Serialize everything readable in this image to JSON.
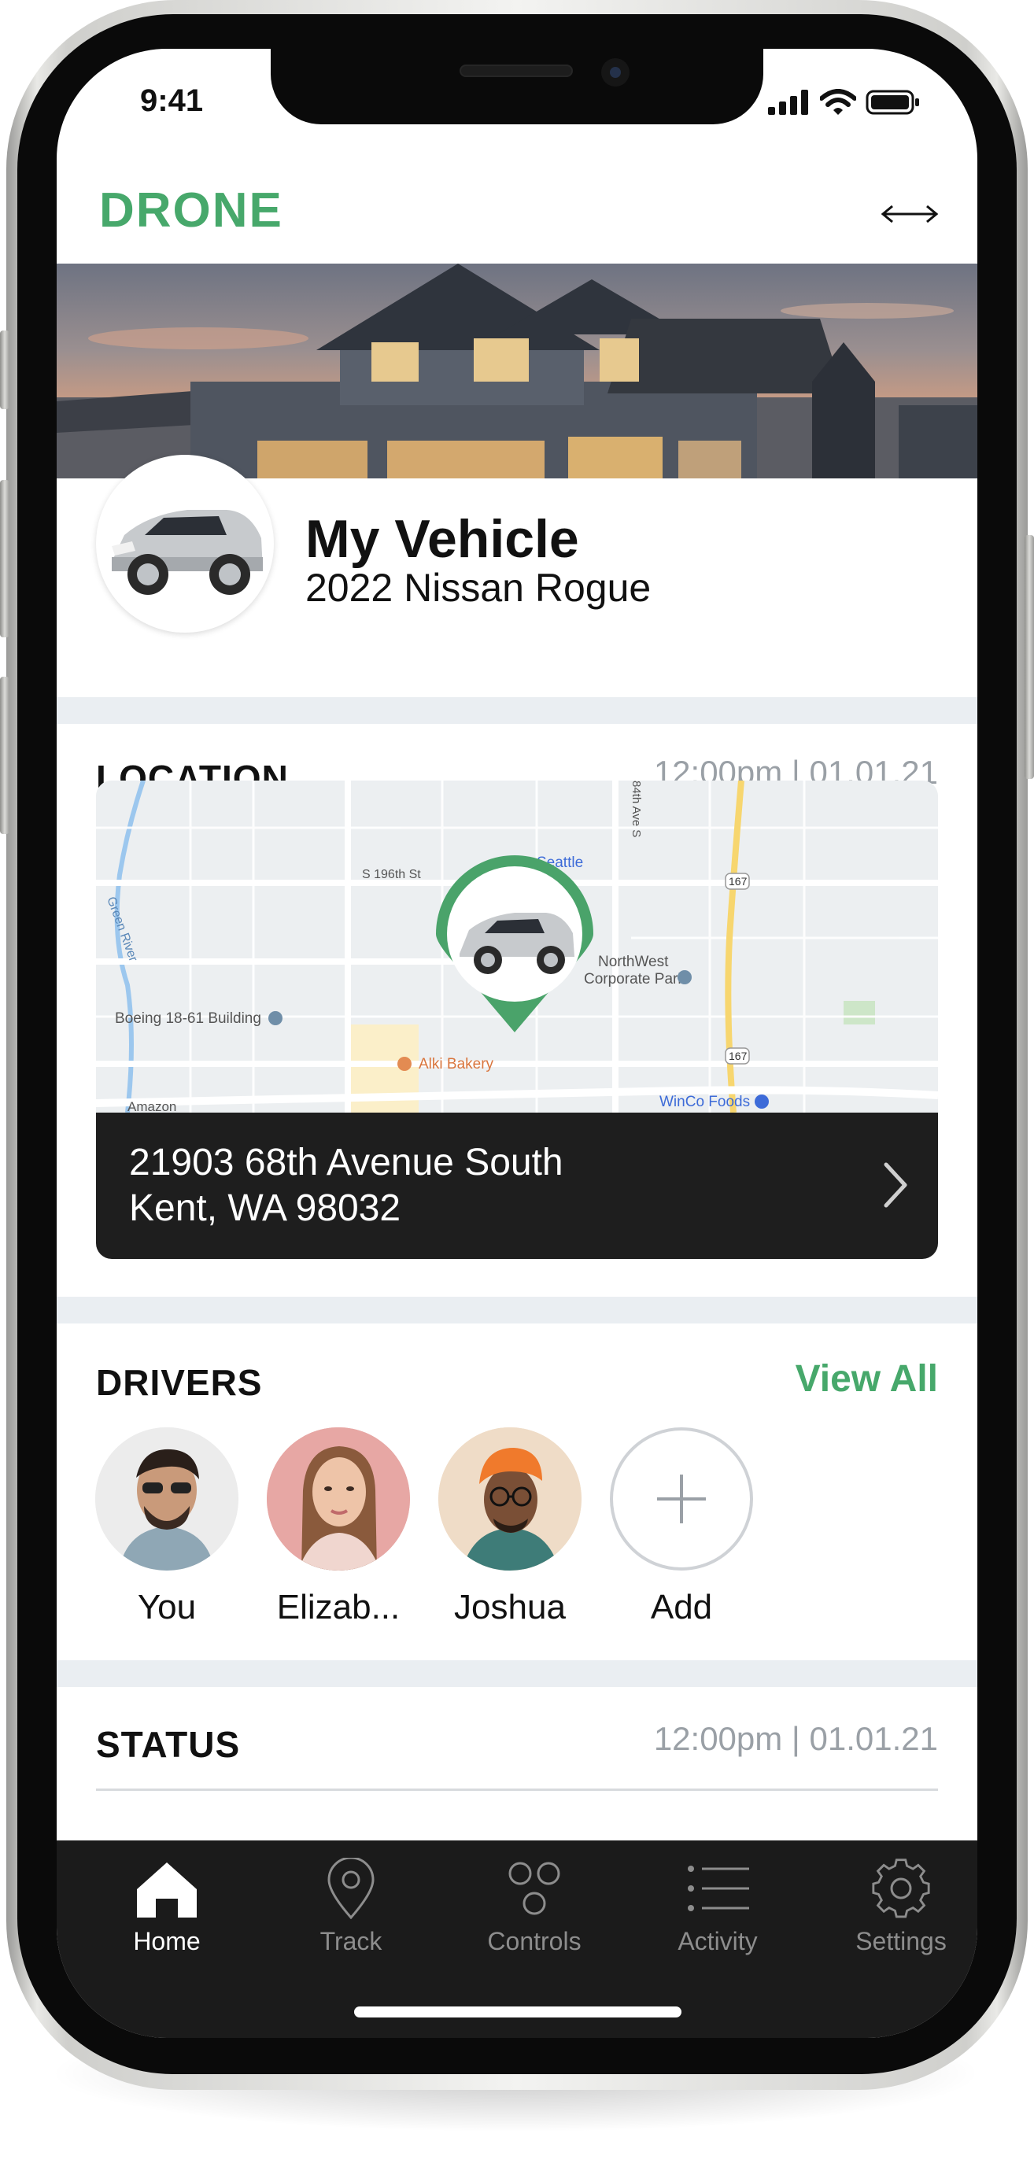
{
  "status_bar": {
    "time": "9:41"
  },
  "header": {
    "logo": "DRONE"
  },
  "vehicle": {
    "title": "My Vehicle",
    "model": "2022 Nissan Rogue"
  },
  "location": {
    "title": "LOCATION",
    "timestamp": "12:00pm | 01.01.21",
    "address_line1": "21903 68th Avenue South",
    "address_line2": "Kent, WA 98032",
    "map_labels": {
      "s196": "S 196th St",
      "seattle": "Seattle",
      "northwest": "NorthWest",
      "corporate_park": "Corporate Park",
      "boeing": "Boeing 18-61 Building",
      "alki": "Alki Bakery",
      "winco": "WinCo Foods",
      "green_river": "Green River",
      "ave84": "84th Ave S",
      "route_a": "167",
      "route_b": "167",
      "amazon": "Amazon"
    }
  },
  "drivers": {
    "title": "DRIVERS",
    "view_all": "View All",
    "items": [
      {
        "name": "You"
      },
      {
        "name": "Elizab..."
      },
      {
        "name": "Joshua"
      }
    ],
    "add_label": "Add"
  },
  "status": {
    "title": "STATUS",
    "timestamp": "12:00pm | 01.01.21"
  },
  "tabs": [
    {
      "label": "Home",
      "icon": "home-icon",
      "active": true
    },
    {
      "label": "Track",
      "icon": "location-pin-icon"
    },
    {
      "label": "Controls",
      "icon": "controls-icon"
    },
    {
      "label": "Activity",
      "icon": "list-icon"
    },
    {
      "label": "Settings",
      "icon": "gear-icon"
    }
  ],
  "colors": {
    "brand": "#47a86b",
    "tabbar": "#1b1b1b",
    "divider": "#eaeef2",
    "muted_text": "#9aa0a6"
  }
}
